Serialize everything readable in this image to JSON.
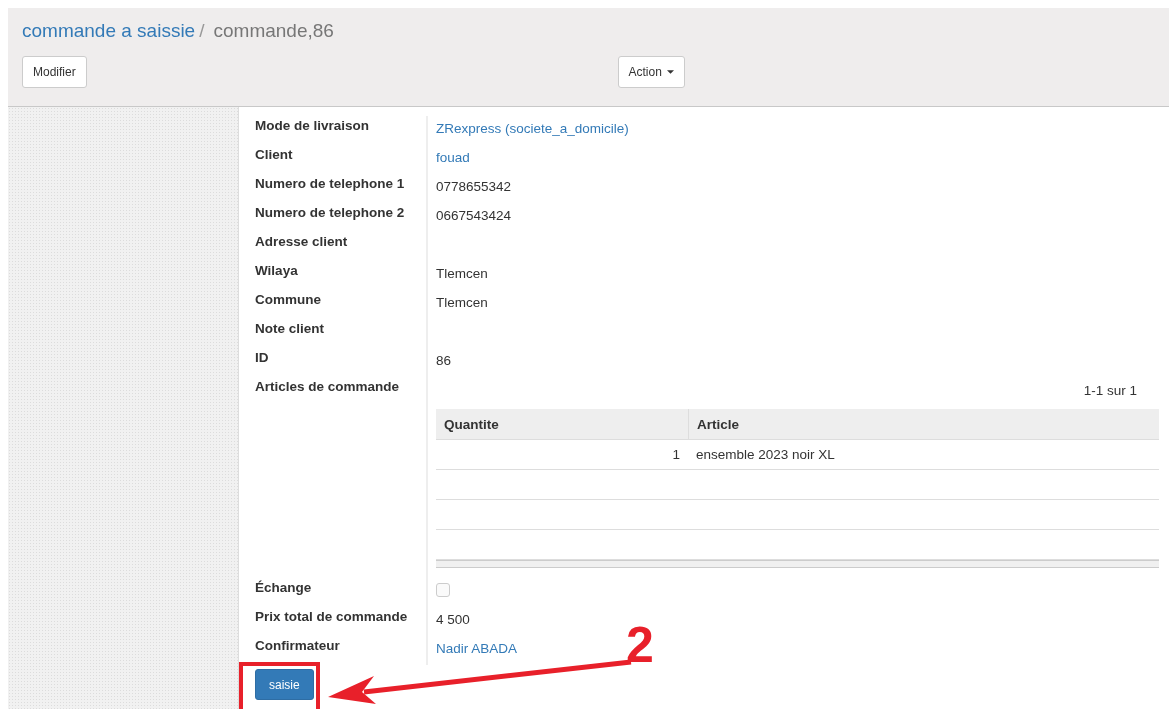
{
  "breadcrumb": [
    {
      "label": "commande a saissie",
      "kind": "link"
    },
    {
      "label": "commande,86",
      "kind": "current"
    }
  ],
  "breadcrumb_separator": "/",
  "toolbar": {
    "edit_button": "Modifier",
    "action_button": "Action"
  },
  "fields": [
    {
      "label": "Mode de livraison",
      "kind": "link",
      "value": "ZRexpress (societe_a_domicile)"
    },
    {
      "label": "Client",
      "kind": "link",
      "value": "fouad"
    },
    {
      "label": "Numero de telephone 1",
      "kind": "text",
      "value": "0778655342"
    },
    {
      "label": "Numero de telephone 2",
      "kind": "text",
      "value": "0667543424"
    },
    {
      "label": "Adresse client",
      "kind": "text"
    },
    {
      "label": "Wilaya",
      "kind": "text",
      "value": "Tlemcen"
    },
    {
      "label": "Commune",
      "kind": "text",
      "value": "Tlemcen"
    },
    {
      "label": "Note client",
      "kind": "text"
    },
    {
      "label": "ID",
      "kind": "text",
      "value": "86"
    },
    {
      "label": "Articles de commande",
      "kind": "table",
      "pagination": "1-1 sur 1",
      "columns": [
        "Quantite",
        "Article"
      ],
      "rows": [
        [
          "1",
          "ensemble 2023 noir XL"
        ]
      ]
    },
    {
      "label": "Échange",
      "kind": "checkbox",
      "checked": false
    },
    {
      "label": "Prix total de commande",
      "kind": "text",
      "value": "4 500"
    },
    {
      "label": "Confirmateur",
      "kind": "link",
      "value": "Nadir ABADA"
    }
  ],
  "submit_button": "saisie",
  "annotation": {
    "label": "2"
  }
}
